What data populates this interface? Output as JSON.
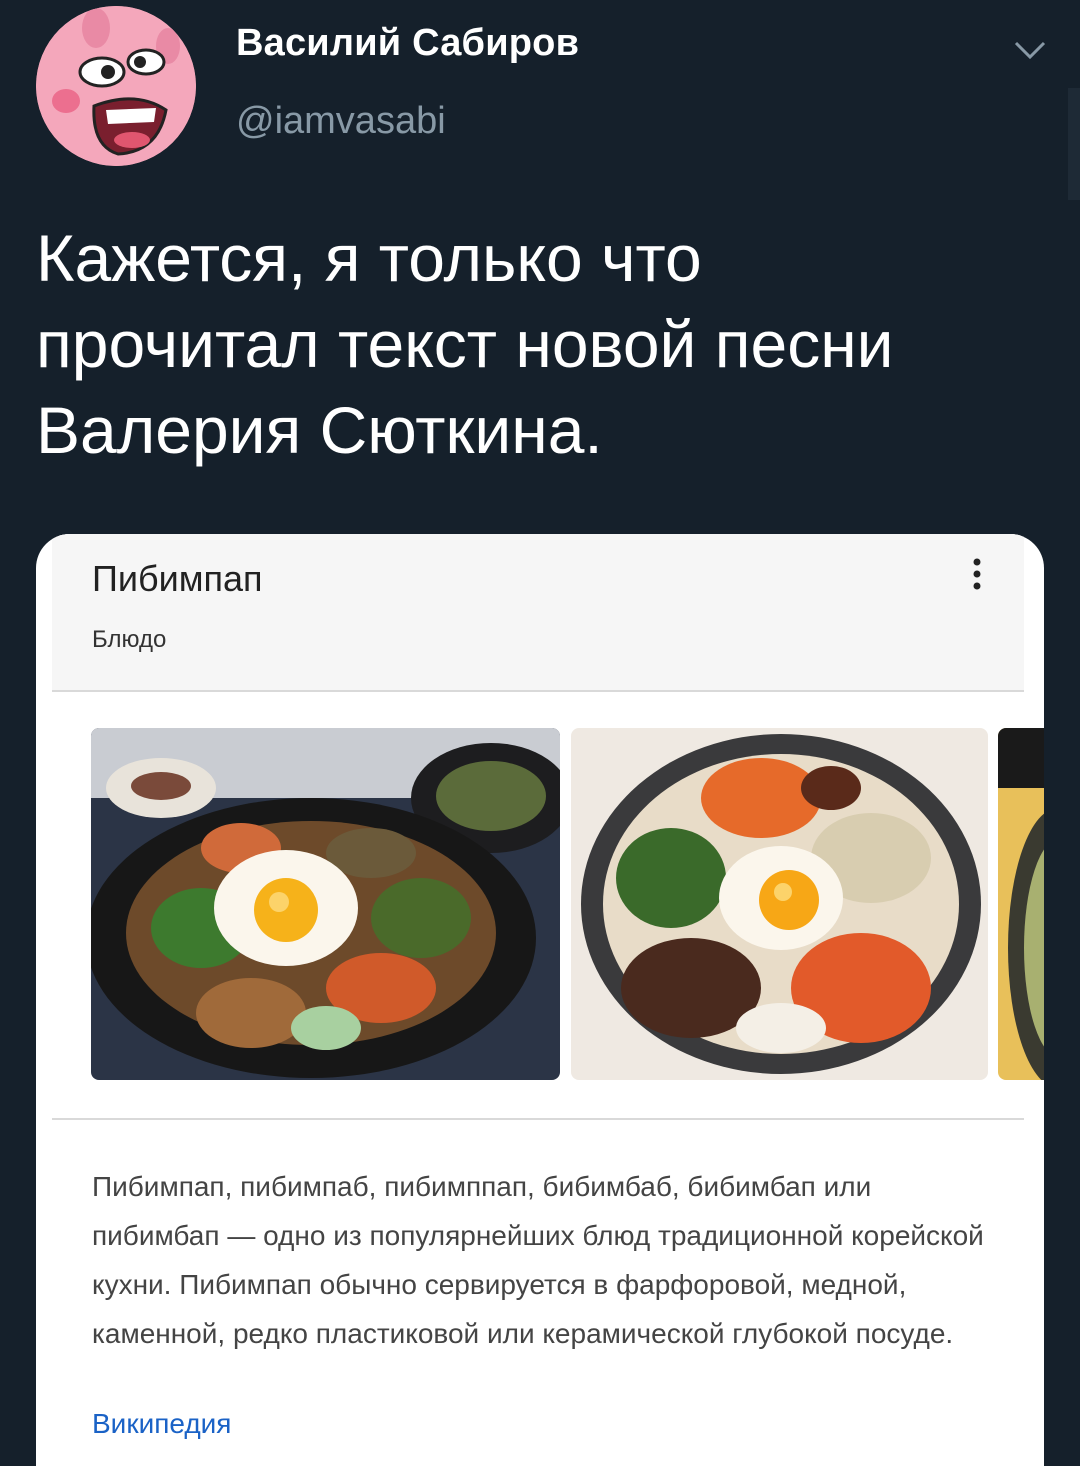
{
  "author": {
    "name": "Василий Сабиров",
    "handle": "@iamvasabi",
    "avatar_icon": "pig-avatar-icon"
  },
  "tweet": {
    "text": "Кажется, я только что\nпрочитал текст новой песни\nВалерия Сюткина."
  },
  "card": {
    "title": "Пибимпап",
    "subtitle": "Блюдо",
    "images": [
      "bibimbap-photo-1",
      "bibimbap-photo-2",
      "bibimbap-photo-3"
    ],
    "description": "Пибимпап, пибимпаб, пибимппап, бибимбаб, бибимбап или пибимбап — одно из популярнейших блюд традиционной корейской кухни. Пибимпап обычно сервируется в фарфоровой, медной, каменной, редко пластиковой или керамической глубокой посуде.",
    "source": "Википедия"
  },
  "colors": {
    "background": "#15202b",
    "handle": "#8899a6",
    "link": "#1a62c6"
  }
}
